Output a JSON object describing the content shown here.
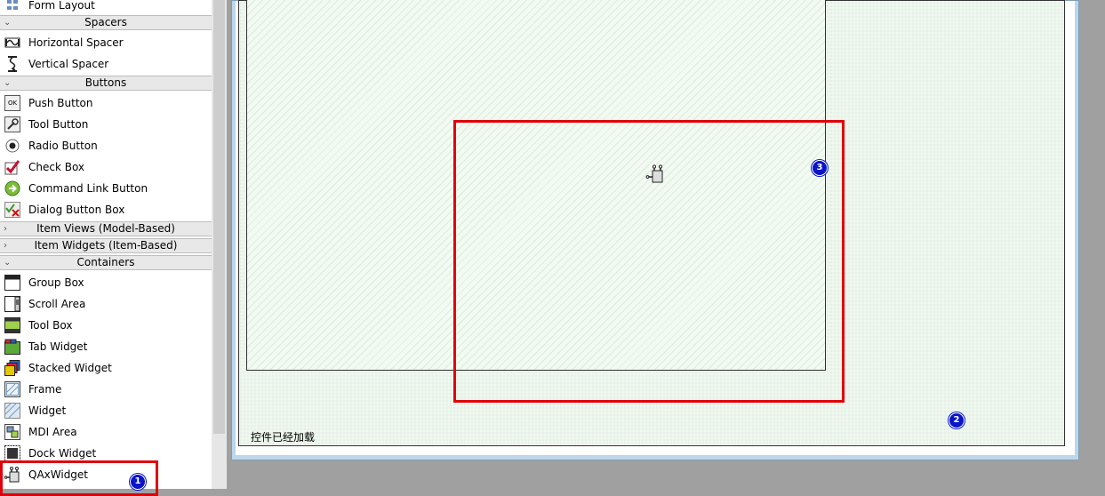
{
  "widget_box": {
    "form_layout": "Form Layout",
    "categories": {
      "spacers": "Spacers",
      "buttons": "Buttons",
      "item_views": "Item Views (Model-Based)",
      "item_widgets": "Item Widgets (Item-Based)",
      "containers": "Containers"
    },
    "items": {
      "horizontal_spacer": "Horizontal Spacer",
      "vertical_spacer": "Vertical Spacer",
      "push_button": "Push Button",
      "tool_button": "Tool Button",
      "radio_button": "Radio Button",
      "check_box": "Check Box",
      "command_link_button": "Command Link Button",
      "dialog_button_box": "Dialog Button Box",
      "group_box": "Group Box",
      "scroll_area": "Scroll Area",
      "tool_box": "Tool Box",
      "tab_widget": "Tab Widget",
      "stacked_widget": "Stacked Widget",
      "frame": "Frame",
      "widget": "Widget",
      "mdi_area": "MDI Area",
      "dock_widget": "Dock Widget",
      "qaxwidget": "QAxWidget"
    },
    "push_button_icon_text": "OK"
  },
  "canvas": {
    "status_text": "控件已经加载"
  },
  "badges": {
    "one": "1",
    "two": "2",
    "three": "3"
  },
  "colors": {
    "highlight": "#e0000a",
    "badge": "#0a14c8"
  }
}
